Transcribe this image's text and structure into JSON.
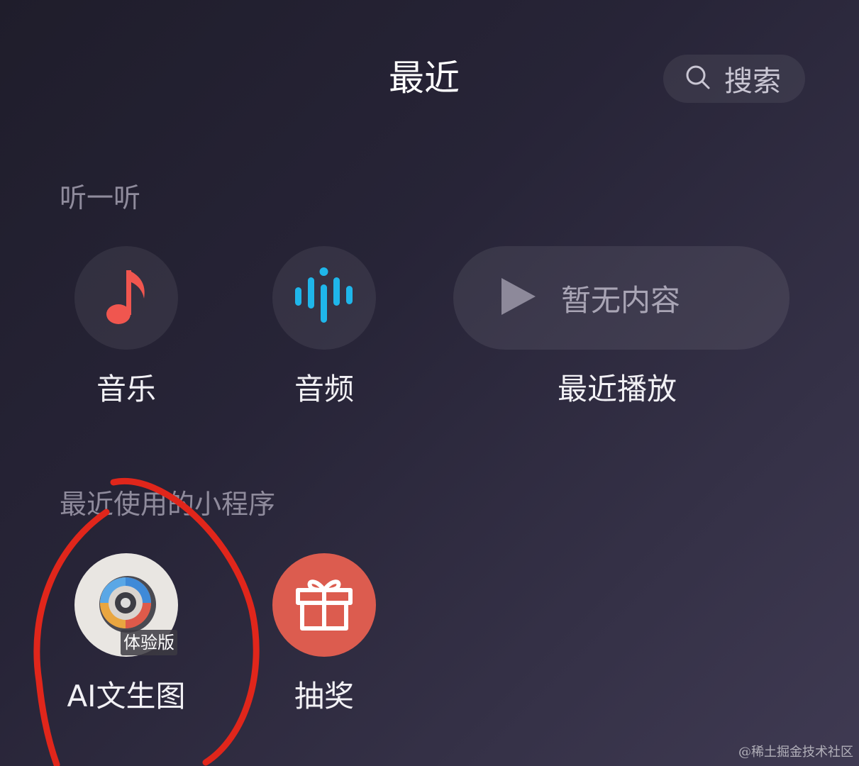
{
  "header": {
    "title": "最近",
    "search_label": "搜索",
    "search_icon": "search-icon"
  },
  "listen": {
    "section_label": "听一听",
    "items": [
      {
        "label": "音乐",
        "icon": "music-note-icon",
        "color": "#f0564f"
      },
      {
        "label": "音频",
        "icon": "audio-wave-icon",
        "color": "#1fb6ea"
      }
    ],
    "recent": {
      "empty_text": "暂无内容",
      "label": "最近播放",
      "icon": "play-icon"
    }
  },
  "mini_programs": {
    "section_label": "最近使用的小程序",
    "items": [
      {
        "label": "AI文生图",
        "badge": "体验版",
        "icon": "camera-lens-icon"
      },
      {
        "label": "抽奖",
        "icon": "gift-icon",
        "color": "#dc5c4f"
      }
    ]
  },
  "watermark": "@稀土掘金技术社区",
  "annotation_color": "#e0261b"
}
